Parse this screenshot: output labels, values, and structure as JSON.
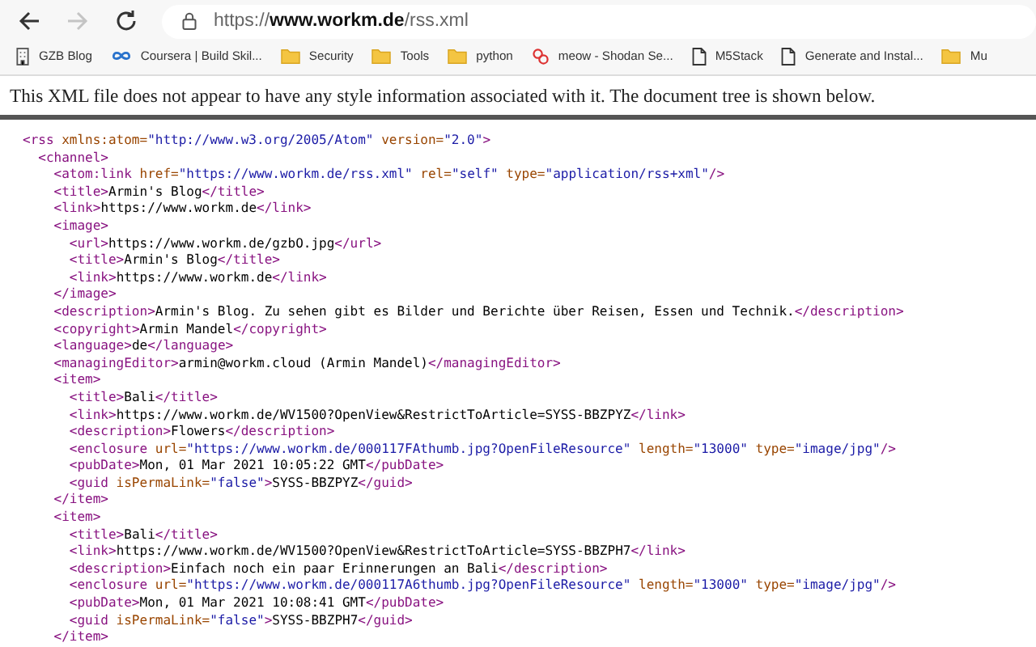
{
  "toolbar": {
    "back_enabled": true,
    "forward_enabled": false
  },
  "address_bar": {
    "url_scheme": "https://",
    "url_host": "www.workm.de",
    "url_path": "/rss.xml"
  },
  "bookmarks": [
    {
      "label": "GZB Blog",
      "kind": "site"
    },
    {
      "label": "Coursera | Build Skil...",
      "kind": "coursera"
    },
    {
      "label": "Security",
      "kind": "folder"
    },
    {
      "label": "Tools",
      "kind": "folder"
    },
    {
      "label": "python",
      "kind": "folder"
    },
    {
      "label": "meow - Shodan Se...",
      "kind": "shodan"
    },
    {
      "label": "M5Stack",
      "kind": "page"
    },
    {
      "label": "Generate and Instal...",
      "kind": "page"
    },
    {
      "label": "Mu",
      "kind": "folder"
    }
  ],
  "notice": "This XML file does not appear to have any style information associated with it. The document tree is shown below.",
  "xml_tree": [
    {
      "tag_start": "<rss",
      "attributes": [
        {
          "name": " xmlns:atom=",
          "value": "\"http://www.w3.org/2005/Atom\""
        },
        {
          "name": " version=",
          "value": "\"2.0\""
        }
      ],
      "tag_end": ">",
      "children": [
        {
          "tag_start": "<channel",
          "tag_end": ">",
          "children": [
            {
              "tag_start": "<atom:link",
              "attributes": [
                {
                  "name": " href=",
                  "value": "\"https://www.workm.de/rss.xml\""
                },
                {
                  "name": " rel=",
                  "value": "\"self\""
                },
                {
                  "name": " type=",
                  "value": "\"application/rss+xml\""
                }
              ],
              "tag_end": "/>"
            },
            {
              "tag_start": "<title",
              "tag_end": ">",
              "text": "Armin's Blog",
              "close_tag": "</title>"
            },
            {
              "tag_start": "<link",
              "tag_end": ">",
              "text": "https://www.workm.de",
              "close_tag": "</link>"
            },
            {
              "tag_start": "<image",
              "tag_end": ">",
              "close_tag": "</image>",
              "children": [
                {
                  "tag_start": "<url",
                  "tag_end": ">",
                  "text": "https://www.workm.de/gzbO.jpg",
                  "close_tag": "</url>"
                },
                {
                  "tag_start": "<title",
                  "tag_end": ">",
                  "text": "Armin's Blog",
                  "close_tag": "</title>"
                },
                {
                  "tag_start": "<link",
                  "tag_end": ">",
                  "text": "https://www.workm.de",
                  "close_tag": "</link>"
                }
              ]
            },
            {
              "tag_start": "<description",
              "tag_end": ">",
              "text": "Armin's Blog. Zu sehen gibt es Bilder und Berichte über Reisen, Essen und Technik.",
              "close_tag": "</description>"
            },
            {
              "tag_start": "<copyright",
              "tag_end": ">",
              "text": "Armin Mandel",
              "close_tag": "</copyright>"
            },
            {
              "tag_start": "<language",
              "tag_end": ">",
              "text": "de",
              "close_tag": "</language>"
            },
            {
              "tag_start": "<managingEditor",
              "tag_end": ">",
              "text": "armin@workm.cloud (Armin Mandel)",
              "close_tag": "</managingEditor>"
            },
            {
              "tag_start": "<item",
              "tag_end": ">",
              "close_tag": "</item>",
              "children": [
                {
                  "tag_start": "<title",
                  "tag_end": ">",
                  "text": "Bali",
                  "close_tag": "</title>"
                },
                {
                  "tag_start": "<link",
                  "tag_end": ">",
                  "text": "https://www.workm.de/WV1500?OpenView&RestrictToArticle=SYSS-BBZPYZ",
                  "close_tag": "</link>"
                },
                {
                  "tag_start": "<description",
                  "tag_end": ">",
                  "text": "Flowers",
                  "close_tag": "</description>"
                },
                {
                  "tag_start": "<enclosure",
                  "attributes": [
                    {
                      "name": " url=",
                      "value": "\"https://www.workm.de/000117FAthumb.jpg?OpenFileResource\""
                    },
                    {
                      "name": " length=",
                      "value": "\"13000\""
                    },
                    {
                      "name": " type=",
                      "value": "\"image/jpg\""
                    }
                  ],
                  "tag_end": "/>"
                },
                {
                  "tag_start": "<pubDate",
                  "tag_end": ">",
                  "text": "Mon, 01 Mar 2021 10:05:22 GMT",
                  "close_tag": "</pubDate>"
                },
                {
                  "tag_start": "<guid",
                  "attributes": [
                    {
                      "name": " isPermaLink=",
                      "value": "\"false\""
                    }
                  ],
                  "tag_end": ">",
                  "text": "SYSS-BBZPYZ",
                  "close_tag": "</guid>"
                }
              ]
            },
            {
              "tag_start": "<item",
              "tag_end": ">",
              "close_tag": "</item>",
              "children": [
                {
                  "tag_start": "<title",
                  "tag_end": ">",
                  "text": "Bali",
                  "close_tag": "</title>"
                },
                {
                  "tag_start": "<link",
                  "tag_end": ">",
                  "text": "https://www.workm.de/WV1500?OpenView&RestrictToArticle=SYSS-BBZPH7",
                  "close_tag": "</link>"
                },
                {
                  "tag_start": "<description",
                  "tag_end": ">",
                  "text": "Einfach noch ein paar Erinnerungen an Bali",
                  "close_tag": "</description>"
                },
                {
                  "tag_start": "<enclosure",
                  "attributes": [
                    {
                      "name": " url=",
                      "value": "\"https://www.workm.de/000117A6thumb.jpg?OpenFileResource\""
                    },
                    {
                      "name": " length=",
                      "value": "\"13000\""
                    },
                    {
                      "name": " type=",
                      "value": "\"image/jpg\""
                    }
                  ],
                  "tag_end": "/>"
                },
                {
                  "tag_start": "<pubDate",
                  "tag_end": ">",
                  "text": "Mon, 01 Mar 2021 10:08:41 GMT",
                  "close_tag": "</pubDate>"
                },
                {
                  "tag_start": "<guid",
                  "attributes": [
                    {
                      "name": " isPermaLink=",
                      "value": "\"false\""
                    }
                  ],
                  "tag_end": ">",
                  "text": "SYSS-BBZPH7",
                  "close_tag": "</guid>"
                }
              ]
            }
          ]
        }
      ]
    }
  ]
}
